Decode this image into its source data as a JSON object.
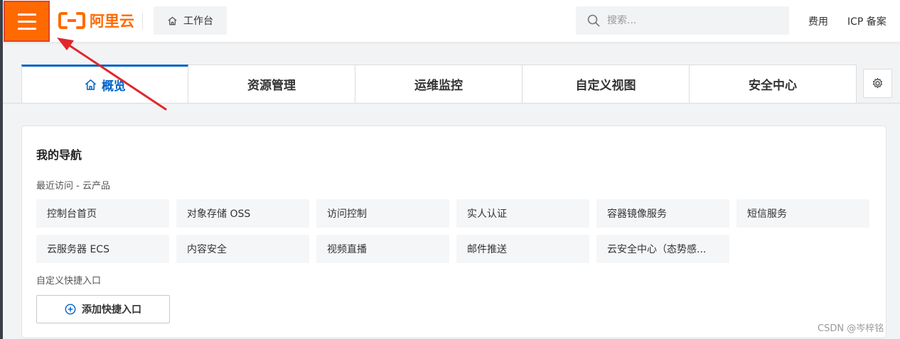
{
  "header": {
    "logo_text": "阿里云",
    "workbench_label": "工作台",
    "search_placeholder": "搜索...",
    "links": [
      "费用",
      "ICP 备案"
    ]
  },
  "tabs": [
    {
      "label": "概览",
      "active": true
    },
    {
      "label": "资源管理",
      "active": false
    },
    {
      "label": "运维监控",
      "active": false
    },
    {
      "label": "自定义视图",
      "active": false
    },
    {
      "label": "安全中心",
      "active": false
    }
  ],
  "nav": {
    "title": "我的导航",
    "recent_label": "最近访问 - 云产品",
    "recent_items": [
      "控制台首页",
      "对象存储 OSS",
      "访问控制",
      "实人认证",
      "容器镜像服务",
      "短信服务",
      "云服务器 ECS",
      "内容安全",
      "视频直播",
      "邮件推送",
      "云安全中心（态势感..."
    ],
    "custom_label": "自定义快捷入口",
    "add_button": "添加快捷入口"
  },
  "watermark": "CSDN @岑梓铭",
  "colors": {
    "brand_orange": "#ff6a00",
    "active_blue": "#0064c8",
    "annotation_red": "#e0262c"
  },
  "icons": {
    "menu": "hamburger-icon",
    "home": "home-icon",
    "search": "search-icon",
    "settings": "gear-icon",
    "add": "plus-circle-icon"
  }
}
